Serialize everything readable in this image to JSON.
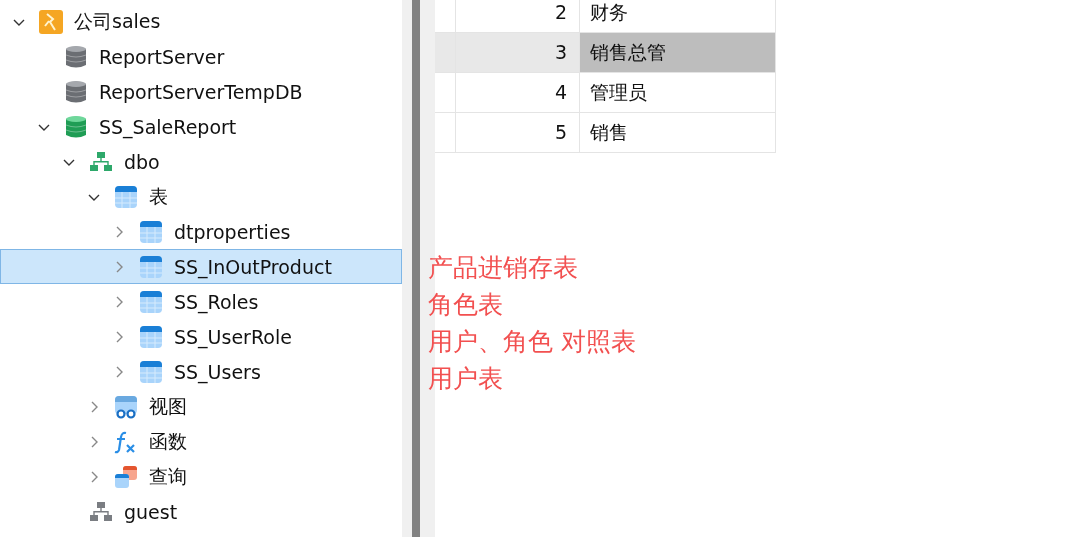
{
  "tree": [
    {
      "label": "公司sales",
      "kind": "connection",
      "expanded": true,
      "selected": false,
      "children": [
        {
          "label": "ReportServer",
          "kind": "database-grey",
          "selected": false
        },
        {
          "label": "ReportServerTempDB",
          "kind": "database-grey",
          "selected": false
        },
        {
          "label": "SS_SaleReport",
          "kind": "database-green",
          "expanded": true,
          "selected": false,
          "children": [
            {
              "label": "dbo",
              "kind": "schema",
              "expanded": true,
              "selected": false,
              "children": [
                {
                  "label": "表",
                  "kind": "table",
                  "expanded": true,
                  "selected": false,
                  "children": [
                    {
                      "label": "dtproperties",
                      "kind": "table",
                      "expanded": false,
                      "selected": false
                    },
                    {
                      "label": "SS_InOutProduct",
                      "kind": "table",
                      "expanded": false,
                      "selected": true
                    },
                    {
                      "label": "SS_Roles",
                      "kind": "table",
                      "expanded": false,
                      "selected": false
                    },
                    {
                      "label": "SS_UserRole",
                      "kind": "table",
                      "expanded": false,
                      "selected": false
                    },
                    {
                      "label": "SS_Users",
                      "kind": "table",
                      "expanded": false,
                      "selected": false
                    }
                  ]
                },
                {
                  "label": "视图",
                  "kind": "view",
                  "expanded": false,
                  "selected": false
                },
                {
                  "label": "函数",
                  "kind": "function",
                  "expanded": false,
                  "selected": false
                },
                {
                  "label": "查询",
                  "kind": "query",
                  "expanded": false,
                  "selected": false
                }
              ]
            },
            {
              "label": "guest",
              "kind": "schema-grey",
              "selected": false
            }
          ]
        }
      ]
    }
  ],
  "table": {
    "rows": [
      {
        "column_1": "2",
        "column_2": "财务",
        "selected": false
      },
      {
        "column_1": "3",
        "column_2": "销售总管",
        "selected": true
      },
      {
        "column_1": "4",
        "column_2": "管理员",
        "selected": false
      },
      {
        "column_1": "5",
        "column_2": "销售",
        "selected": false
      }
    ]
  },
  "annotations": [
    "产品进销存表",
    "角色表",
    "用户、角色 对照表",
    "用户表"
  ]
}
